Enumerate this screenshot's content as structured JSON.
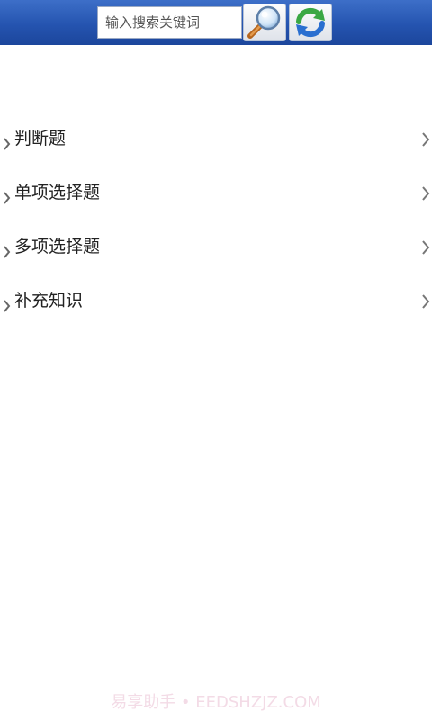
{
  "search": {
    "placeholder": "输入搜索关键词"
  },
  "menu": {
    "items": [
      {
        "label": "判断题"
      },
      {
        "label": "单项选择题"
      },
      {
        "label": "多项选择题"
      },
      {
        "label": "补充知识"
      }
    ]
  },
  "watermark": {
    "text": "易享助手 • EEDSHZJZ.COM"
  },
  "icons": {
    "search": "magnifier-icon",
    "refresh": "refresh-icon",
    "item_left": "chevron-right-small-icon",
    "item_right": "chevron-right-icon"
  },
  "colors": {
    "topbar": "#2554b0",
    "refresh_green": "#3aa844",
    "refresh_blue": "#2a6fd0",
    "text": "#222222",
    "chevron": "#777777",
    "watermark": "#f3dbe6"
  }
}
